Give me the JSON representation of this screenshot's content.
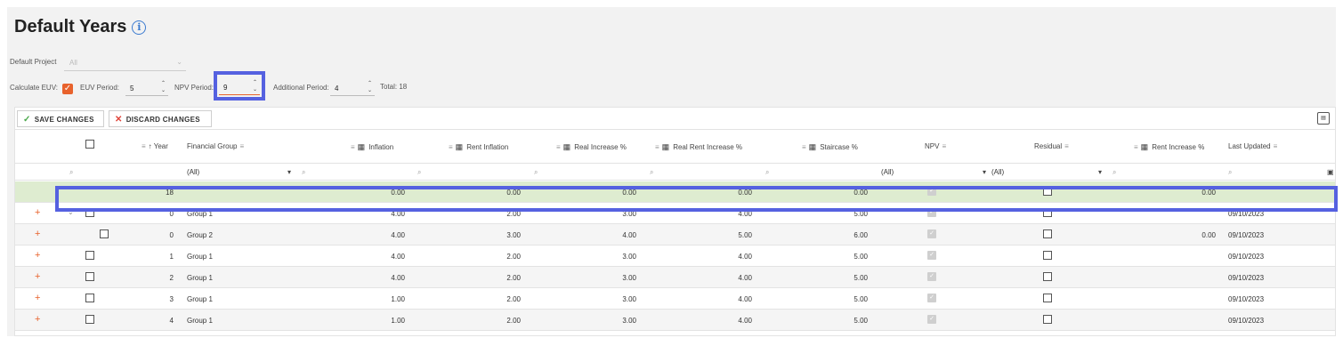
{
  "page": {
    "title": "Default Years",
    "info_icon": "info-icon"
  },
  "settings": {
    "default_project_label": "Default Project",
    "default_project_value": "All",
    "calculate_euv_label": "Calculate EUV:",
    "calculate_euv_checked": true,
    "euv_period_label": "EUV Period:",
    "euv_period_value": "5",
    "npv_period_label": "NPV Period:",
    "npv_period_value": "9",
    "additional_period_label": "Additional Period:",
    "additional_period_value": "4",
    "total_text": "Total: 18"
  },
  "toolbar": {
    "save_label": "SAVE CHANGES",
    "discard_label": "DISCARD CHANGES",
    "column_chooser_icon": "column-chooser-icon"
  },
  "columns": {
    "year": "Year",
    "year_sort": "↑",
    "financial_group": "Financial Group",
    "inflation": "Inflation",
    "rent_inflation": "Rent Inflation",
    "real_increase": "Real Increase %",
    "real_rent_increase": "Real Rent Increase %",
    "staircase": "Staircase %",
    "npv": "NPV",
    "residual": "Residual",
    "rent_increase": "Rent Increase %",
    "last_updated": "Last Updated"
  },
  "filters": {
    "financial_group": "(All)",
    "npv": "(All)",
    "residual": "(All)"
  },
  "summary_row": {
    "year": "18",
    "inflation": "0.00",
    "rent_inflation": "0.00",
    "real_increase": "0.00",
    "real_rent_increase": "0.00",
    "staircase": "0.00",
    "rent_increase": "0.00"
  },
  "rows": [
    {
      "year": "0",
      "group": "Group 1",
      "inflation": "4.00",
      "rent_inflation": "2.00",
      "real_increase": "3.00",
      "real_rent_increase": "4.00",
      "staircase": "5.00",
      "rent_increase": "",
      "last_updated": "09/10/2023"
    },
    {
      "year": "0",
      "group": "Group 2",
      "inflation": "4.00",
      "rent_inflation": "3.00",
      "real_increase": "4.00",
      "real_rent_increase": "5.00",
      "staircase": "6.00",
      "rent_increase": "0.00",
      "last_updated": "09/10/2023"
    },
    {
      "year": "1",
      "group": "Group 1",
      "inflation": "4.00",
      "rent_inflation": "2.00",
      "real_increase": "3.00",
      "real_rent_increase": "4.00",
      "staircase": "5.00",
      "rent_increase": "",
      "last_updated": "09/10/2023"
    },
    {
      "year": "2",
      "group": "Group 1",
      "inflation": "4.00",
      "rent_inflation": "2.00",
      "real_increase": "3.00",
      "real_rent_increase": "4.00",
      "staircase": "5.00",
      "rent_increase": "",
      "last_updated": "09/10/2023"
    },
    {
      "year": "3",
      "group": "Group 1",
      "inflation": "1.00",
      "rent_inflation": "2.00",
      "real_increase": "3.00",
      "real_rent_increase": "4.00",
      "staircase": "5.00",
      "rent_increase": "",
      "last_updated": "09/10/2023"
    },
    {
      "year": "4",
      "group": "Group 1",
      "inflation": "1.00",
      "rent_inflation": "2.00",
      "real_increase": "3.00",
      "real_rent_increase": "4.00",
      "staircase": "5.00",
      "rent_increase": "",
      "last_updated": "09/10/2023"
    }
  ],
  "colors": {
    "accent": "#e8622c",
    "highlight_border": "#5561e0",
    "summary_bg": "#deecd0"
  }
}
